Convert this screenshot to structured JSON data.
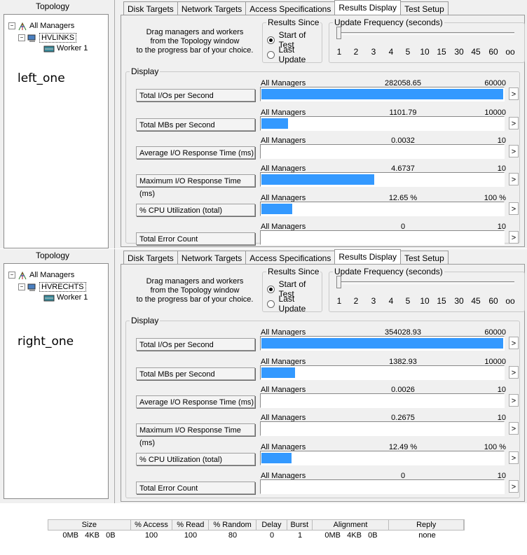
{
  "panels": [
    {
      "annotation": "left_one",
      "topology": {
        "title": "Topology",
        "root": "All Managers",
        "manager": "HVLINKS",
        "worker": "Worker 1"
      },
      "tabs": [
        "Disk Targets",
        "Network Targets",
        "Access Specifications",
        "Results Display",
        "Test Setup"
      ],
      "active_tab": "Results Display",
      "drag_text": [
        "Drag managers and workers",
        "from the Topology window",
        "to the progress bar of your choice."
      ],
      "results_since": {
        "title": "Results Since",
        "options": [
          "Start of Test",
          "Last Update"
        ],
        "selected": "Start of Test"
      },
      "update_freq": {
        "title": "Update Frequency (seconds)",
        "ticks": [
          "1",
          "2",
          "3",
          "4",
          "5",
          "10",
          "15",
          "30",
          "45",
          "60",
          "oo"
        ]
      },
      "display_title": "Display",
      "rows": [
        {
          "label": "Total I/Os per Second",
          "manager": "All Managers",
          "value": "282058.65",
          "max": "60000",
          "fill": 1.0
        },
        {
          "label": "Total MBs per Second",
          "manager": "All Managers",
          "value": "1101.79",
          "max": "10000",
          "fill": 0.11
        },
        {
          "label": "Average I/O Response Time (ms)",
          "manager": "All Managers",
          "value": "0.0032",
          "max": "10",
          "fill": 0.0
        },
        {
          "label": "Maximum I/O Response Time (ms)",
          "manager": "All Managers",
          "value": "4.6737",
          "max": "10",
          "fill": 0.467
        },
        {
          "label": "% CPU Utilization (total)",
          "manager": "All Managers",
          "value": "12.65 %",
          "max": "100 %",
          "fill": 0.1265
        },
        {
          "label": "Total Error Count",
          "manager": "All Managers",
          "value": "0",
          "max": "10",
          "fill": 0.0
        }
      ]
    },
    {
      "annotation": "right_one",
      "topology": {
        "title": "Topology",
        "root": "All Managers",
        "manager": "HVRECHTS",
        "worker": "Worker 1"
      },
      "tabs": [
        "Disk Targets",
        "Network Targets",
        "Access Specifications",
        "Results Display",
        "Test Setup"
      ],
      "active_tab": "Results Display",
      "drag_text": [
        "Drag managers and workers",
        "from the Topology window",
        "to the progress bar of your choice."
      ],
      "results_since": {
        "title": "Results Since",
        "options": [
          "Start of Test",
          "Last Update"
        ],
        "selected": "Start of Test"
      },
      "update_freq": {
        "title": "Update Frequency (seconds)",
        "ticks": [
          "1",
          "2",
          "3",
          "4",
          "5",
          "10",
          "15",
          "30",
          "45",
          "60",
          "oo"
        ]
      },
      "display_title": "Display",
      "rows": [
        {
          "label": "Total I/Os per Second",
          "manager": "All Managers",
          "value": "354028.93",
          "max": "60000",
          "fill": 1.0
        },
        {
          "label": "Total MBs per Second",
          "manager": "All Managers",
          "value": "1382.93",
          "max": "10000",
          "fill": 0.138
        },
        {
          "label": "Average I/O Response Time (ms)",
          "manager": "All Managers",
          "value": "0.0026",
          "max": "10",
          "fill": 0.0
        },
        {
          "label": "Maximum I/O Response Time (ms)",
          "manager": "All Managers",
          "value": "0.2675",
          "max": "10",
          "fill": 0.0
        },
        {
          "label": "% CPU Utilization (total)",
          "manager": "All Managers",
          "value": "12.49 %",
          "max": "100 %",
          "fill": 0.1249
        },
        {
          "label": "Total Error Count",
          "manager": "All Managers",
          "value": "0",
          "max": "10",
          "fill": 0.0
        }
      ]
    }
  ],
  "access_spec": {
    "headers": [
      "Size",
      "% Access",
      "% Read",
      "% Random",
      "Delay",
      "Burst",
      "Alignment",
      "Reply"
    ],
    "row": [
      "0MB   4KB   0B",
      "100",
      "100",
      "80",
      "0",
      "1",
      "0MB   4KB   0B",
      "none"
    ]
  },
  "colors": {
    "bar_fill": "#3399ff",
    "window_bg": "#f0f0f0"
  }
}
